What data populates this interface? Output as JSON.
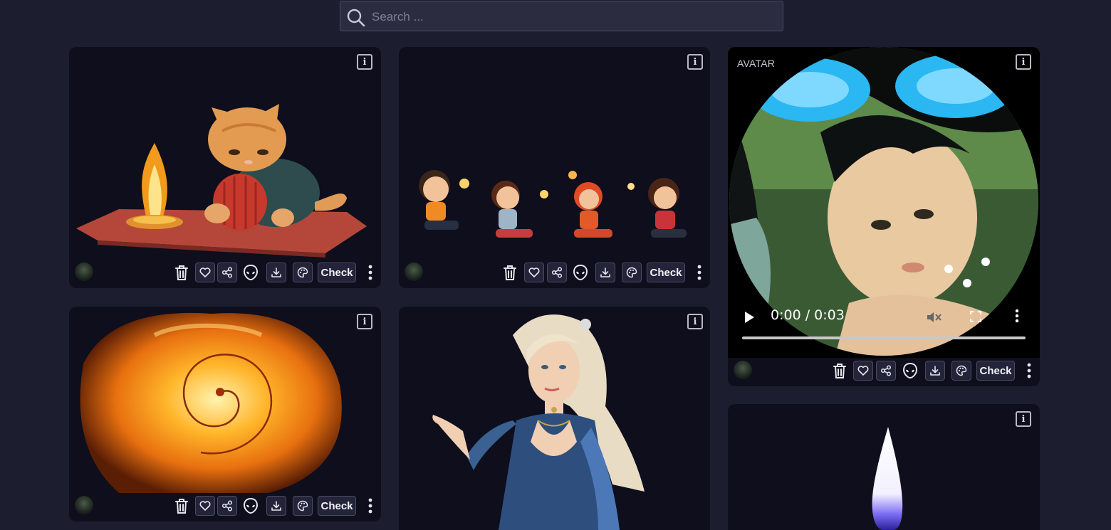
{
  "search": {
    "placeholder": "Search ...",
    "value": ""
  },
  "actions": {
    "check_label": "Check"
  },
  "cards": [
    {
      "id": "cat-campfire",
      "tag": ""
    },
    {
      "id": "kids-sparklers",
      "tag": ""
    },
    {
      "id": "avatar-video",
      "tag": "AVATAR",
      "video": {
        "time": "0:00 / 0:03"
      }
    },
    {
      "id": "fire-spiral",
      "tag": ""
    },
    {
      "id": "blonde-woman",
      "tag": ""
    },
    {
      "id": "candle-flame",
      "tag": ""
    }
  ],
  "icons": [
    "search-icon",
    "info-icon",
    "trash-icon",
    "heart-icon",
    "share-icon",
    "alien-icon",
    "download-icon",
    "palette-icon",
    "more-icon",
    "play-icon",
    "mute-icon",
    "fullscreen-icon"
  ],
  "colors": {
    "background": "#1c1d2e",
    "card": "#0e0e1c",
    "search_bg": "#2b2c40",
    "button_bg": "#23243a",
    "button_border": "#4b4c5e"
  }
}
